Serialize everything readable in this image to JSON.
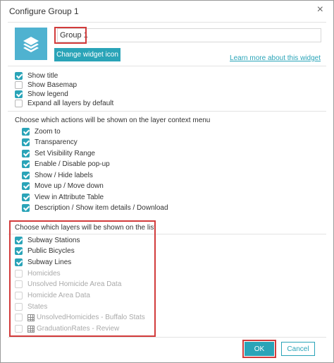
{
  "dialog": {
    "title": "Configure Group 1",
    "close_glyph": "×"
  },
  "widget": {
    "name_value": "Group 1",
    "change_icon_label": "Change widget icon",
    "learn_more_label": "Learn more about this widget",
    "icon": "layers-icon"
  },
  "options": [
    {
      "label": "Show title",
      "checked": true
    },
    {
      "label": "Show Basemap",
      "checked": false
    },
    {
      "label": "Show legend",
      "checked": true
    },
    {
      "label": "Expand all layers by default",
      "checked": false
    }
  ],
  "actions": {
    "heading": "Choose which actions will be shown on the layer context menu",
    "items": [
      {
        "label": "Zoom to",
        "checked": true
      },
      {
        "label": "Transparency",
        "checked": true
      },
      {
        "label": "Set Visibility Range",
        "checked": true
      },
      {
        "label": "Enable / Disable pop-up",
        "checked": true
      },
      {
        "label": "Show / Hide labels",
        "checked": true
      },
      {
        "label": "Move up / Move down",
        "checked": true
      },
      {
        "label": "View in Attribute Table",
        "checked": true
      },
      {
        "label": "Description / Show item details / Download",
        "checked": true
      }
    ]
  },
  "layers": {
    "heading": "Choose which layers will be shown on the list",
    "items": [
      {
        "label": "Subway Stations",
        "checked": true,
        "dim": false,
        "table_icon": false
      },
      {
        "label": "Public Bicycles",
        "checked": true,
        "dim": false,
        "table_icon": false
      },
      {
        "label": "Subway Lines",
        "checked": true,
        "dim": false,
        "table_icon": false
      },
      {
        "label": "Homicides",
        "checked": false,
        "dim": true,
        "table_icon": false
      },
      {
        "label": "Unsolved Homicide Area Data",
        "checked": false,
        "dim": true,
        "table_icon": false
      },
      {
        "label": "Homicide Area Data",
        "checked": false,
        "dim": true,
        "table_icon": false
      },
      {
        "label": "States",
        "checked": false,
        "dim": true,
        "table_icon": false
      },
      {
        "label": "UnsolvedHomicides - Buffalo Stats",
        "checked": false,
        "dim": true,
        "table_icon": true
      },
      {
        "label": "GraduationRates - Review",
        "checked": false,
        "dim": true,
        "table_icon": true
      }
    ]
  },
  "footer": {
    "ok_label": "OK",
    "cancel_label": "Cancel"
  },
  "colors": {
    "accent": "#2aa4b8",
    "highlight": "#d23b3b",
    "tile": "#4fb2d0"
  }
}
